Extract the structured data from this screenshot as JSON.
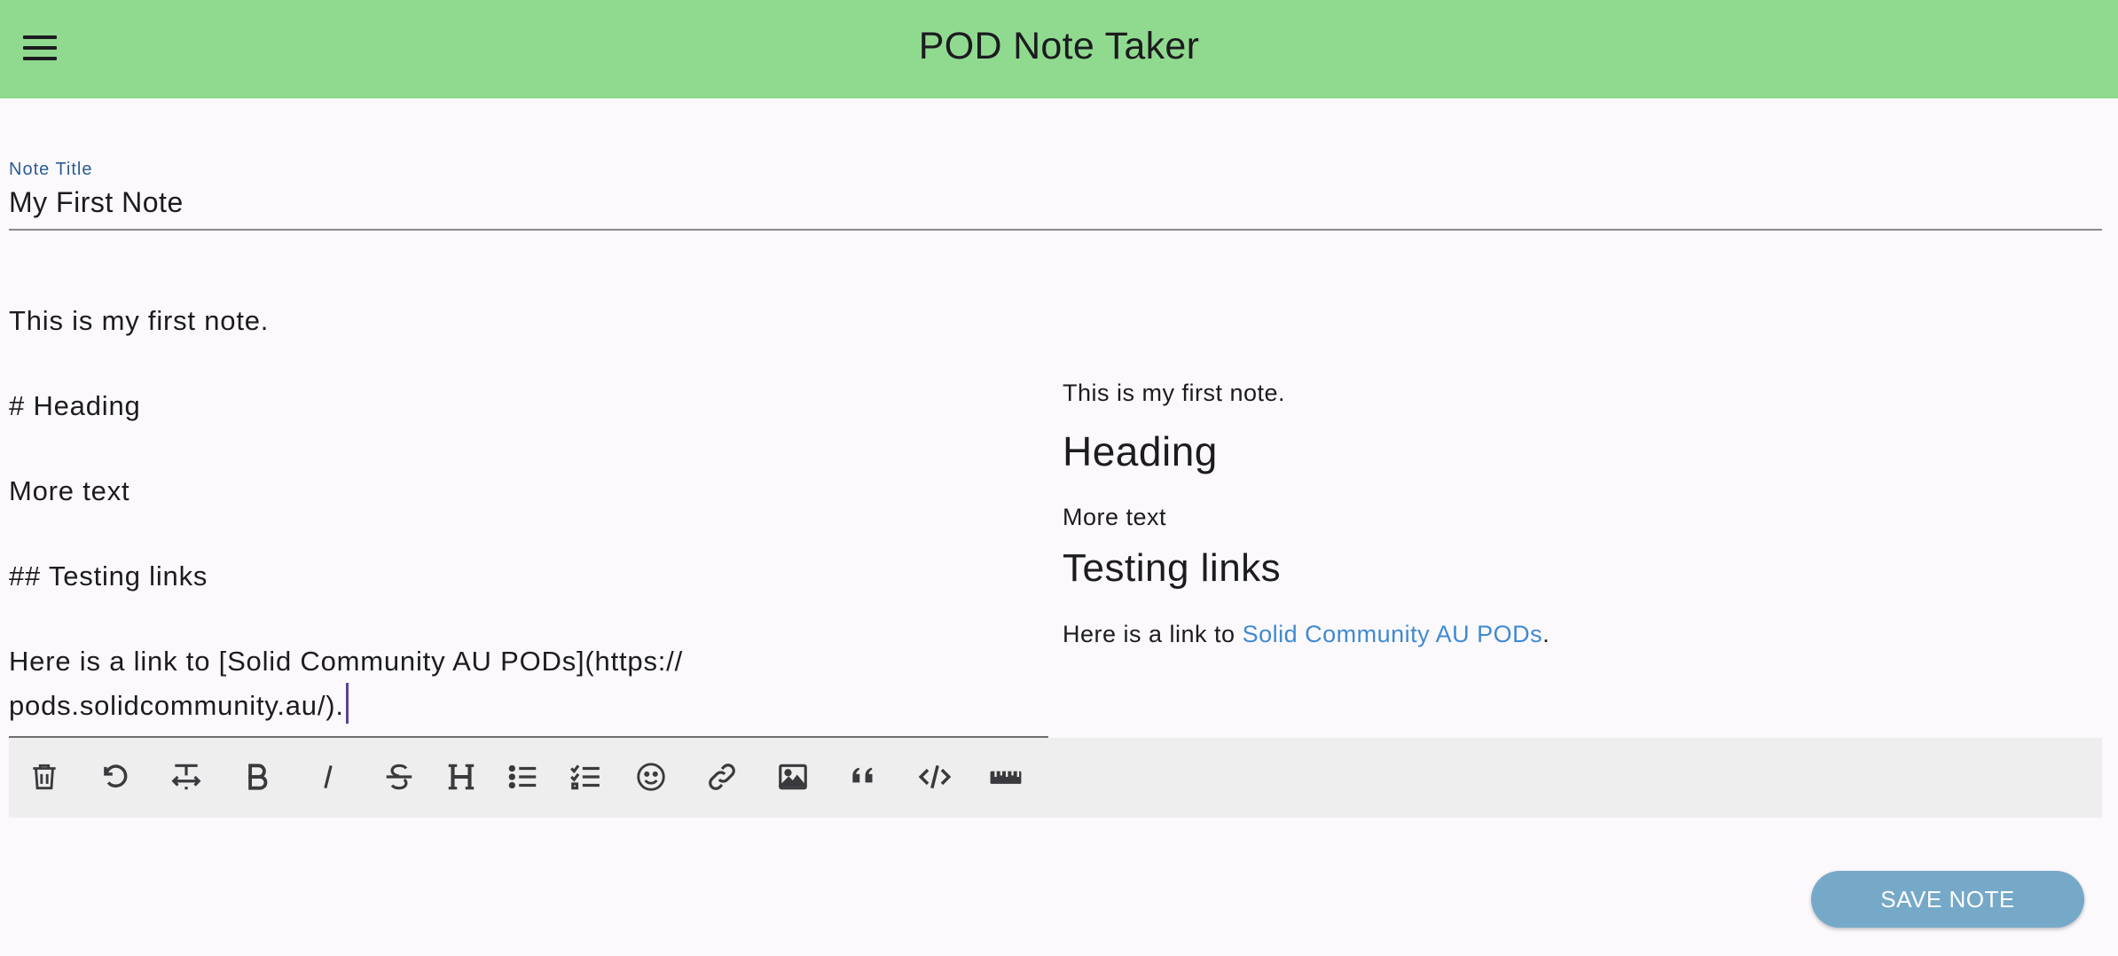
{
  "appbar": {
    "title": "POD Note Taker",
    "menu_icon": "hamburger-menu-icon",
    "background": "#90da90"
  },
  "note": {
    "title_label": "Note Title",
    "title_value": "My First Note",
    "editor_lines": [
      "This is my first note.",
      "# Heading",
      "More text",
      "## Testing links",
      "Here is a link to [Solid Community AU PODs](https://",
      "pods.solidcommunity.au/)."
    ]
  },
  "preview": {
    "paragraph1": "This is my first note.",
    "heading1": "Heading",
    "paragraph2": "More text",
    "heading2": "Testing links",
    "link_prefix": "Here is a link to ",
    "link_text": "Solid Community AU PODs",
    "link_suffix": ".",
    "link_color": "#3f8ad1"
  },
  "toolbar": {
    "tools": [
      {
        "name": "delete",
        "icon": "trash-icon"
      },
      {
        "name": "undo",
        "icon": "undo-icon"
      },
      {
        "name": "text-format",
        "icon": "text-resize-icon"
      },
      {
        "name": "bold",
        "icon": "bold-icon"
      },
      {
        "name": "italic",
        "icon": "italic-icon"
      },
      {
        "name": "strikethrough",
        "icon": "strikethrough-icon"
      },
      {
        "name": "heading",
        "icon": "heading-icon"
      },
      {
        "name": "bullet-list",
        "icon": "bullet-list-icon"
      },
      {
        "name": "checklist",
        "icon": "checklist-icon"
      },
      {
        "name": "emoji",
        "icon": "emoji-icon"
      },
      {
        "name": "link",
        "icon": "link-icon"
      },
      {
        "name": "image",
        "icon": "image-icon"
      },
      {
        "name": "quote",
        "icon": "quote-icon"
      },
      {
        "name": "code",
        "icon": "code-icon"
      },
      {
        "name": "horizontal-rule",
        "icon": "ruler-icon"
      }
    ]
  },
  "actions": {
    "save_label": "SAVE NOTE",
    "save_color": "#76a9c8"
  }
}
